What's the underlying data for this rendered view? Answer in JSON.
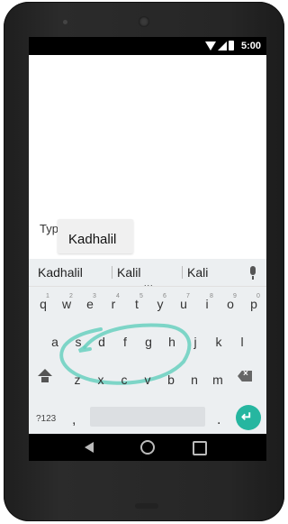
{
  "status_bar": {
    "time": "5:00",
    "icons": [
      "wifi-icon",
      "signal-icon",
      "battery-icon"
    ]
  },
  "text_field": {
    "typed_text": "Typing is",
    "composing_word": "Kadhalil"
  },
  "suggestions": {
    "items": [
      "Kadhalil",
      "Kalil",
      "Kali"
    ],
    "more": "...",
    "mic_icon": "mic-icon"
  },
  "keyboard": {
    "row1": [
      "q",
      "w",
      "e",
      "r",
      "t",
      "y",
      "u",
      "i",
      "o",
      "p"
    ],
    "row1_hints": [
      "1",
      "2",
      "3",
      "4",
      "5",
      "6",
      "7",
      "8",
      "9",
      "0"
    ],
    "row2": [
      "a",
      "s",
      "d",
      "f",
      "g",
      "h",
      "j",
      "k",
      "l"
    ],
    "row3": [
      "z",
      "x",
      "c",
      "v",
      "b",
      "n",
      "m"
    ],
    "shift_icon": "shift-icon",
    "backspace_icon": "backspace-icon",
    "symbols_label": "?123",
    "comma_label": ",",
    "period_label": ".",
    "enter_icon": "enter-icon"
  },
  "colors": {
    "accent": "#26b6a0",
    "keyboard_bg": "#eceff1",
    "gesture_trail": "#6ad0c0"
  },
  "nav_bar": {
    "icons": [
      "back-icon",
      "home-icon",
      "recents-icon"
    ]
  }
}
